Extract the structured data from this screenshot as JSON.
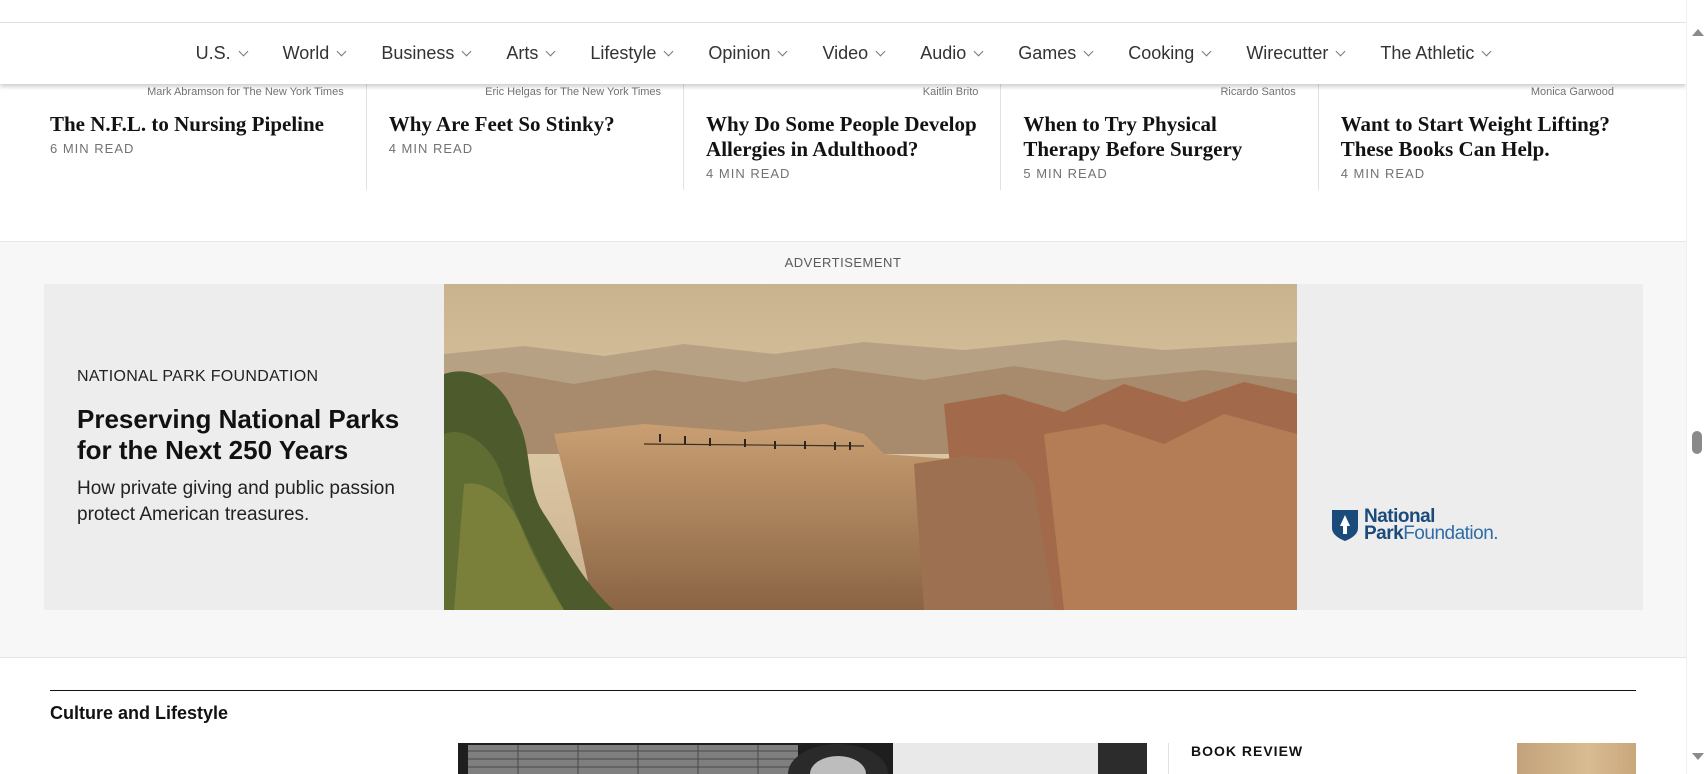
{
  "nav": {
    "items": [
      {
        "label": "U.S."
      },
      {
        "label": "World"
      },
      {
        "label": "Business"
      },
      {
        "label": "Arts"
      },
      {
        "label": "Lifestyle"
      },
      {
        "label": "Opinion"
      },
      {
        "label": "Video"
      },
      {
        "label": "Audio"
      },
      {
        "label": "Games"
      },
      {
        "label": "Cooking"
      },
      {
        "label": "Wirecutter"
      },
      {
        "label": "The Athletic"
      }
    ]
  },
  "stories": [
    {
      "credit": "Mark Abramson for The New York Times",
      "headline": "The N.F.L. to Nursing Pipeline",
      "meta": "6 MIN READ"
    },
    {
      "credit": "Eric Helgas for The New York Times",
      "headline": "Why Are Feet So Stinky?",
      "meta": "4 MIN READ"
    },
    {
      "credit": "Kaitlin Brito",
      "headline": "Why Do Some People Develop Allergies in Adulthood?",
      "meta": "4 MIN READ"
    },
    {
      "credit": "Ricardo Santos",
      "headline": "When to Try Physical Therapy Before Surgery",
      "meta": "5 MIN READ"
    },
    {
      "credit": "Monica Garwood",
      "headline": "Want to Start Weight Lifting? These Books Can Help.",
      "meta": "4 MIN READ"
    }
  ],
  "ad": {
    "label": "ADVERTISEMENT",
    "sponsor": "NATIONAL PARK FOUNDATION",
    "title": "Preserving National Parks for the Next 250 Years",
    "subtitle": "How private giving and public passion protect American treasures.",
    "logo_line1": "National",
    "logo_line2_bold": "Park",
    "logo_line2_light": "Foundation."
  },
  "culture": {
    "section_title": "Culture and Lifestyle",
    "book_review_label": "BOOK REVIEW"
  },
  "colors": {
    "text": "#121212",
    "muted": "#727272",
    "ad_background": "#f7f7f7",
    "npf_blue": "#1b4b7a"
  }
}
